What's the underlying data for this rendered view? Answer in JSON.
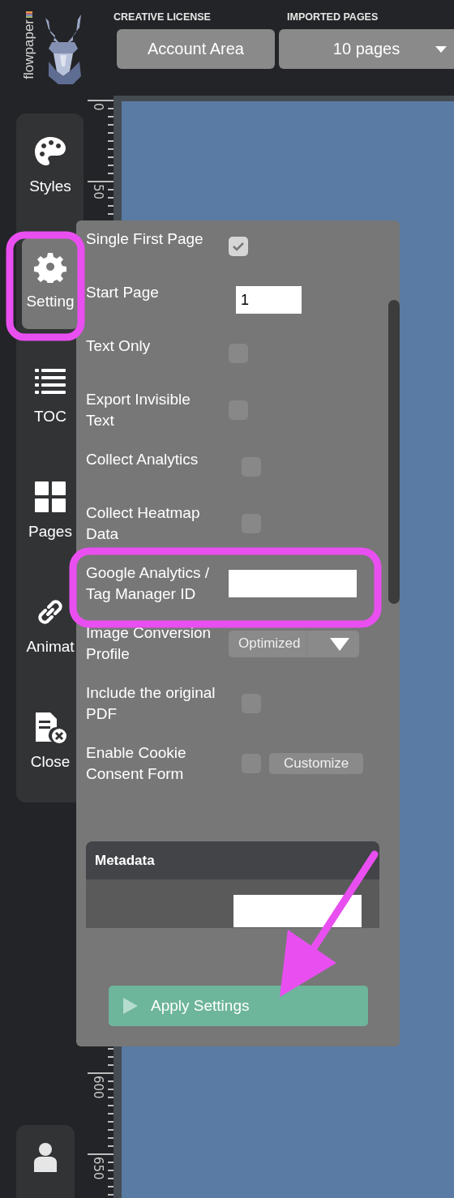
{
  "header": {
    "logo_text": "flowpaper",
    "license_label": "CREATIVE LICENSE",
    "account_button": "Account Area",
    "pages_label": "IMPORTED PAGES",
    "pages_dropdown": "10 pages"
  },
  "nav": [
    {
      "label": "Styles",
      "selected": false
    },
    {
      "label": "Setting",
      "selected": true
    },
    {
      "label": "TOC",
      "selected": false
    },
    {
      "label": "Pages",
      "selected": false
    },
    {
      "label": "Animat",
      "selected": false
    },
    {
      "label": "Close",
      "selected": false
    }
  ],
  "ruler": {
    "labels": [
      "0",
      "50",
      "600",
      "650"
    ]
  },
  "settings": {
    "rows": [
      {
        "kind": "checkbox",
        "label": "Single First Page",
        "checked": true
      },
      {
        "kind": "text",
        "label": "Start Page",
        "value": "1"
      },
      {
        "kind": "checkbox",
        "label": "Text Only",
        "checked": false
      },
      {
        "kind": "checkbox",
        "label": "Export Invisible Text",
        "checked": false
      },
      {
        "kind": "checkbox",
        "label": "Collect Analytics",
        "checked": false
      },
      {
        "kind": "checkbox",
        "label": "Collect Heatmap Data",
        "checked": false
      },
      {
        "kind": "text",
        "label": "Google Analytics / Tag Manager ID"
      },
      {
        "kind": "dropdown",
        "label": "Image Conversion Profile",
        "value": "Optimized"
      },
      {
        "kind": "checkbox",
        "label": "Include the original PDF",
        "checked": false
      },
      {
        "kind": "checkbox",
        "label": "Enable Cookie Consent Form",
        "checked": false,
        "button": "Customize"
      }
    ],
    "metadata_title": "Metadata",
    "apply_button": "Apply Settings"
  }
}
